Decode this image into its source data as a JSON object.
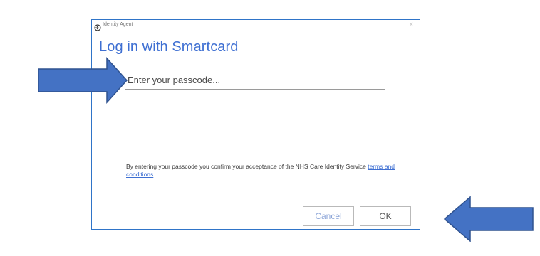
{
  "window": {
    "app_name": "Identity Agent",
    "close_glyph": "×"
  },
  "dialog": {
    "title": "Log in with Smartcard"
  },
  "passcode": {
    "placeholder": "Enter your passcode...",
    "value": ""
  },
  "terms": {
    "text": "By entering your passcode you confirm your acceptance of the NHS Care Identity Service ",
    "link": "terms and conditions",
    "suffix": "."
  },
  "buttons": {
    "cancel": "Cancel",
    "ok": "OK"
  },
  "annotations": {
    "arrow_color": "#4472c4",
    "arrow_outline": "#2f528f"
  }
}
